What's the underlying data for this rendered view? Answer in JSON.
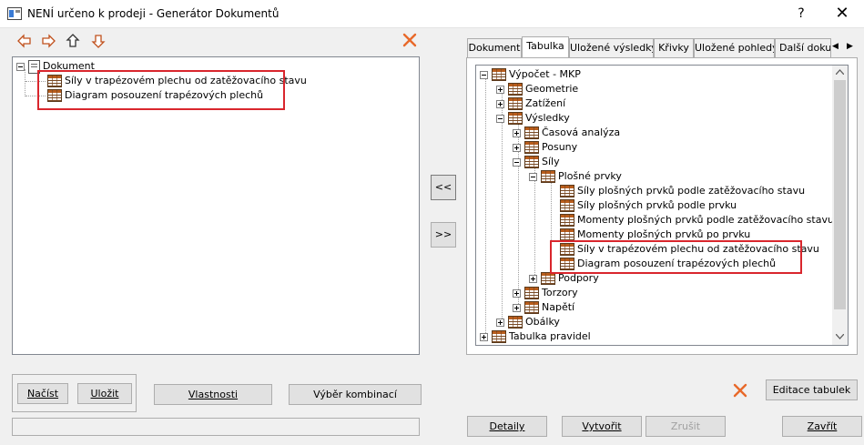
{
  "window": {
    "title": "NENÍ určeno k prodeji - Generátor Dokumentů",
    "help_glyph": "?",
    "close_glyph": "✕"
  },
  "left_toolbar": {
    "icons": [
      "arrow-left-icon",
      "arrow-right-icon",
      "arrow-up-icon",
      "arrow-down-icon"
    ]
  },
  "document_tree": {
    "root_label": "Dokument",
    "items": [
      "Síly v trapézovém plechu od zatěžovacího stavu",
      "Diagram posouzení trapézových plechů"
    ]
  },
  "middle_buttons": {
    "add_label": "<<",
    "remove_label": ">>"
  },
  "tabs": [
    "Dokument",
    "Tabulka",
    "Uložené výsledky",
    "Křivky",
    "Uložené pohledy",
    "Další doku"
  ],
  "active_tab": "Tabulka",
  "tab_scroll": {
    "left": "◀",
    "right": "▶"
  },
  "table_tree": {
    "root": "Výpočet - MKP",
    "nodes": {
      "geometrie": "Geometrie",
      "zatizeni": "Zatížení",
      "vysledky": "Výsledky",
      "casova_analyza": "Časová analýza",
      "posuny": "Posuny",
      "sily": "Síly",
      "plosne_prvky": "Plošné prvky",
      "sily_plosnych_zs": "Síly plošných prvků podle zatěžovacího stavu",
      "sily_plosnych_prvku": "Síly plošných prvků podle prvku",
      "momenty_zs": "Momenty plošných prvků podle zatěžovacího stavu",
      "momenty_po_prvku": "Momenty plošných prvků po prvku",
      "sily_trapez": "Síly v trapézovém plechu od zatěžovacího stavu",
      "diagram_trapez": "Diagram posouzení trapézových plechů",
      "podpory": "Podpory",
      "torzory": "Torzory",
      "napeti": "Napětí",
      "obalky": "Obálky",
      "tabulka_pravidel": "Tabulka pravidel"
    }
  },
  "bottom_left_buttons": {
    "nacist": "Načíst",
    "ulozit": "Uložit",
    "vlastnosti": "Vlastnosti",
    "vyber_kombinaci": "Výběr kombinací"
  },
  "right_buttons": {
    "editace_tabulek": "Editace tabulek",
    "detaily": "Detaily",
    "vytvorit": "Vytvořit",
    "zrusit": "Zrušit",
    "zavrit": "Zavřít"
  },
  "colors": {
    "highlight_box": "#d9262d",
    "delete_icon": "#e8692a"
  }
}
